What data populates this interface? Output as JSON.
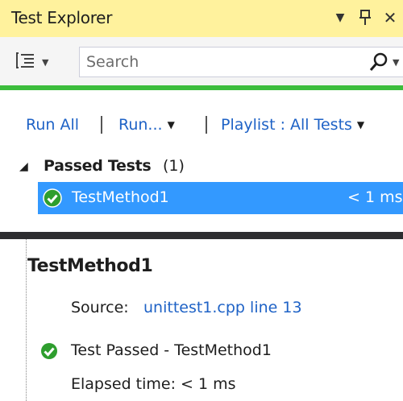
{
  "window": {
    "title": "Test Explorer",
    "dropdown_icon": "dropdown-arrow-icon",
    "pin_icon": "pin-icon",
    "close_icon": "close-icon"
  },
  "toolbar": {
    "group_by_icon": "group-by-icon",
    "search_placeholder": "Search",
    "search_icon": "search-icon"
  },
  "progress": {
    "fraction": 1.0,
    "color": "#3cbd3c"
  },
  "commands": {
    "run_all": "Run All",
    "run": "Run...",
    "playlist": "Playlist : All Tests"
  },
  "tree": {
    "group_name": "Passed Tests",
    "group_count": "(1)",
    "tests": [
      {
        "name": "TestMethod1",
        "duration": "< 1 ms",
        "status": "passed"
      }
    ]
  },
  "detail": {
    "title": "TestMethod1",
    "source_label": "Source:",
    "source_link": "unittest1.cpp line 13",
    "status_text": "Test Passed - TestMethod1",
    "elapsed": "Elapsed time: < 1 ms"
  },
  "colors": {
    "title_bg": "#fff29d",
    "selection": "#3399ff",
    "link": "#1e62c6",
    "pass_green": "#2e9e2e"
  }
}
